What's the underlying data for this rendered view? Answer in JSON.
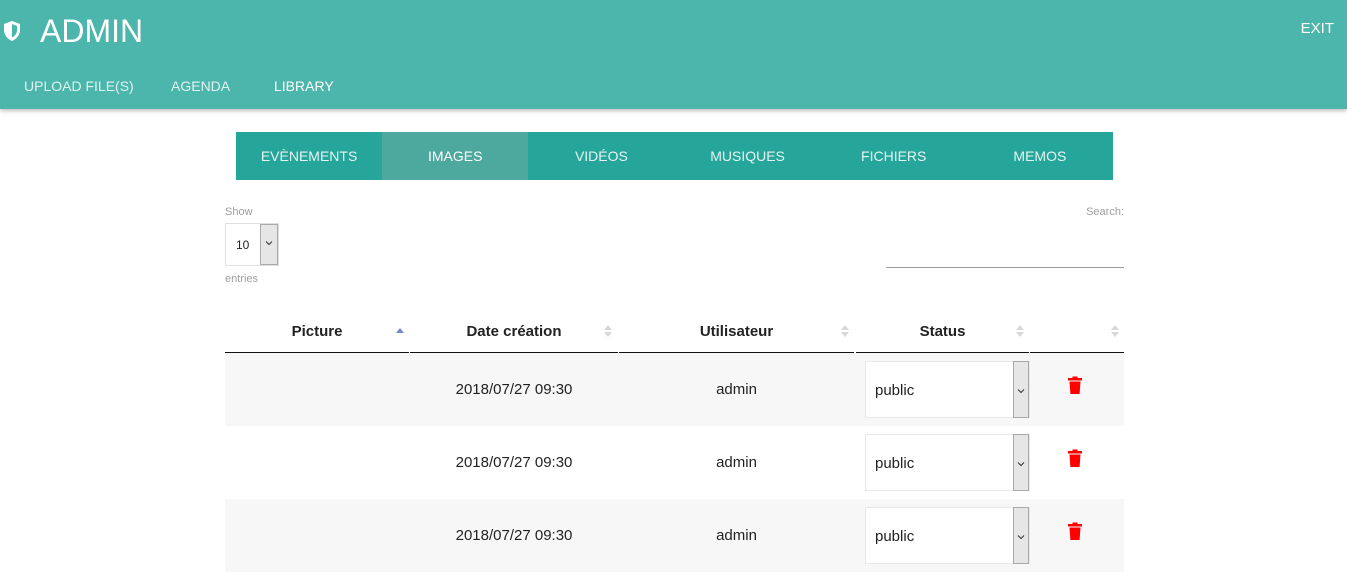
{
  "header": {
    "title": "ADMIN",
    "exit_label": "EXIT"
  },
  "nav": {
    "items": [
      {
        "label": "UPLOAD FILE(S)"
      },
      {
        "label": "AGENDA"
      },
      {
        "label": "LIBRARY"
      }
    ]
  },
  "tabs": [
    {
      "label": "EVÈNEMENTS"
    },
    {
      "label": "IMAGES"
    },
    {
      "label": "VIDÉOS"
    },
    {
      "label": "MUSIQUES"
    },
    {
      "label": "FICHIERS"
    },
    {
      "label": "MEMOS"
    }
  ],
  "length": {
    "show_label": "Show",
    "value": "10",
    "entries_label": "entries"
  },
  "search": {
    "label": "Search:",
    "value": ""
  },
  "table": {
    "columns": [
      "Picture",
      "Date création",
      "Utilisateur",
      "Status",
      ""
    ],
    "rows": [
      {
        "picture": "",
        "date": "2018/07/27 09:30",
        "user": "admin",
        "status": "public"
      },
      {
        "picture": "",
        "date": "2018/07/27 09:30",
        "user": "admin",
        "status": "public"
      },
      {
        "picture": "",
        "date": "2018/07/27 09:30",
        "user": "admin",
        "status": "public"
      }
    ]
  },
  "colors": {
    "header_bg": "#4db6ac",
    "tabs_bg": "#26a69a",
    "tab_active_bg": "#4da89d",
    "delete_icon": "#ff0000",
    "sort_active": "#7986cb"
  },
  "icons": {
    "brand": "shield-icon",
    "delete": "trash-icon",
    "dropdown": "chevron-down-icon",
    "sort": "sort-icon"
  }
}
